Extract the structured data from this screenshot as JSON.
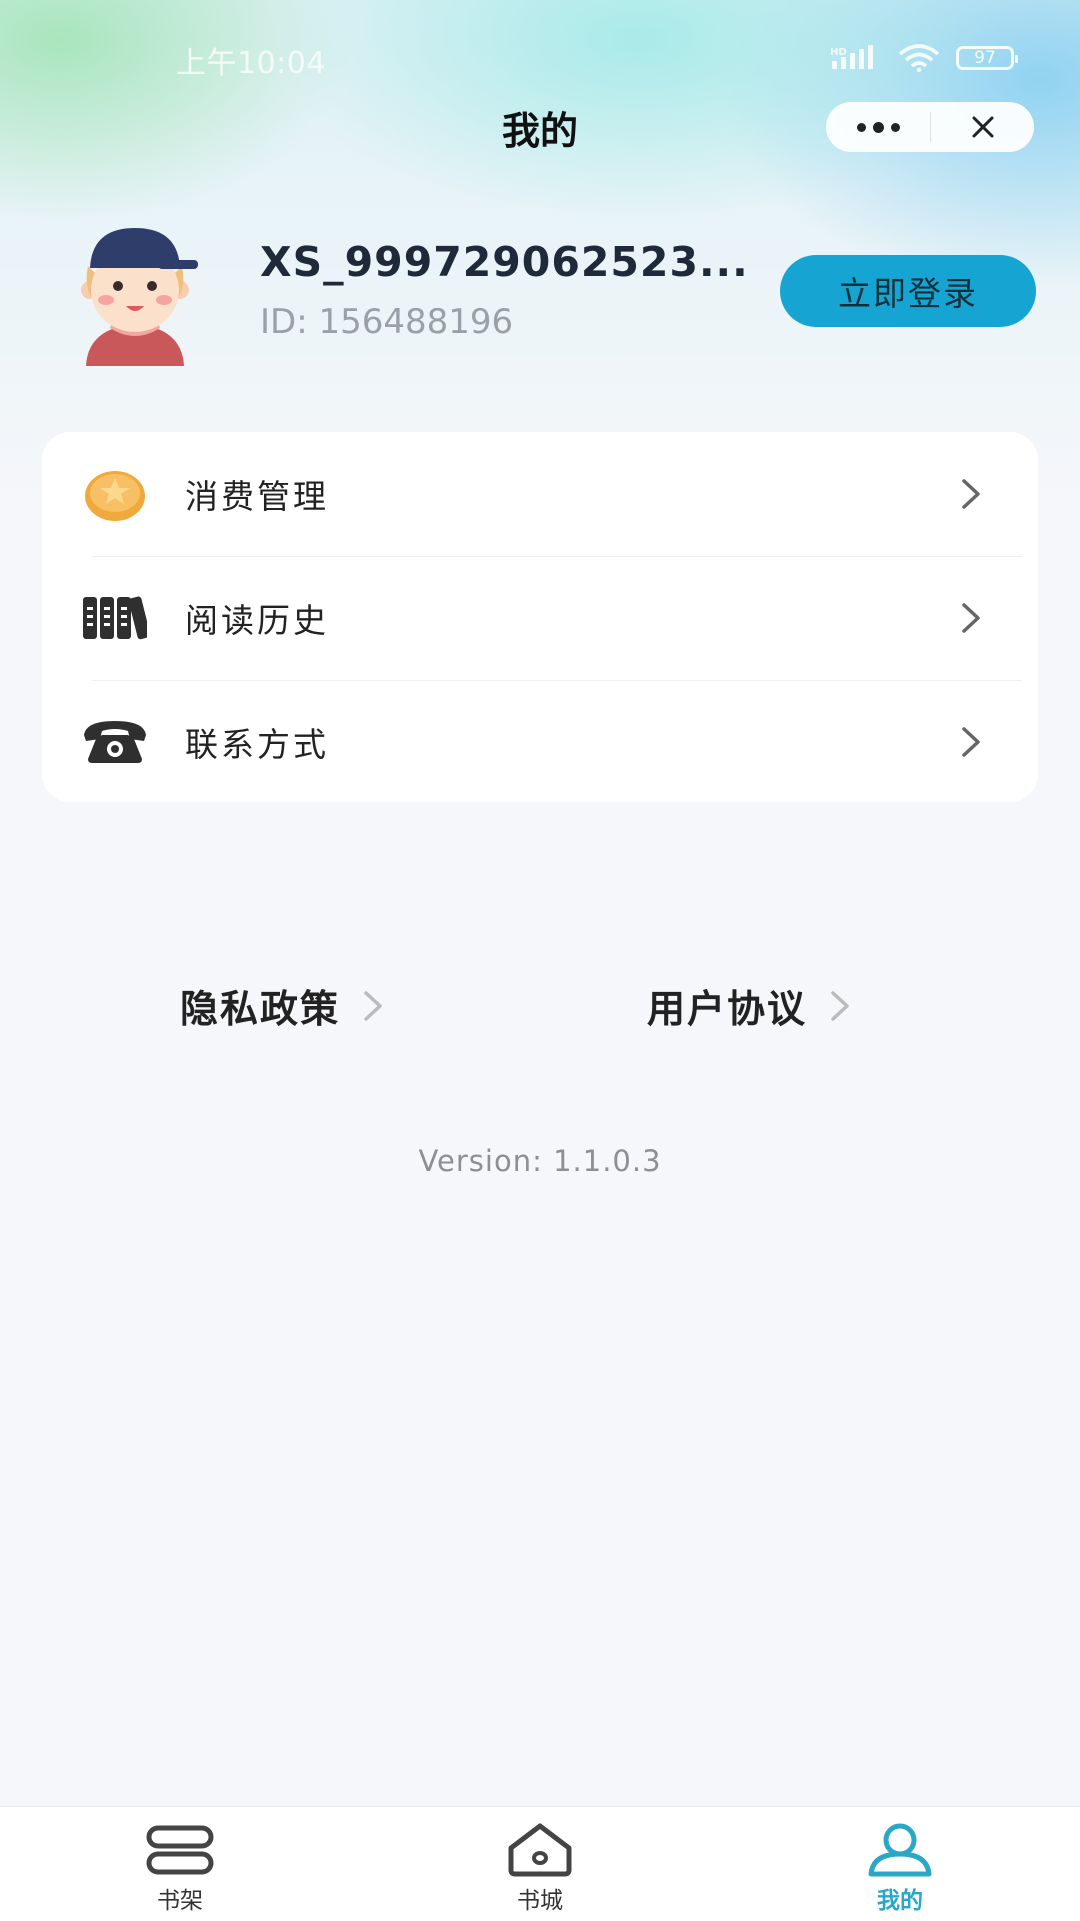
{
  "status_bar": {
    "time": "上午10:04",
    "battery": "97",
    "network_label": "HD"
  },
  "nav": {
    "title": "我的"
  },
  "profile": {
    "username": "XS_999729062523...",
    "id_text": "ID: 156488196",
    "login_label": "立即登录"
  },
  "menu": {
    "items": [
      {
        "label": "消费管理",
        "icon": "coin-icon"
      },
      {
        "label": "阅读历史",
        "icon": "books-icon"
      },
      {
        "label": "联系方式",
        "icon": "telephone-icon"
      }
    ]
  },
  "links": {
    "privacy": "隐私政策",
    "agreement": "用户协议"
  },
  "version": "Version: 1.1.0.3",
  "tabbar": {
    "items": [
      {
        "label": "书架",
        "icon": "bookshelf-icon",
        "active": false
      },
      {
        "label": "书城",
        "icon": "bookstore-icon",
        "active": false
      },
      {
        "label": "我的",
        "icon": "profile-icon",
        "active": true
      }
    ]
  },
  "colors": {
    "accent": "#16a5d2",
    "active_tab": "#2aa7c6",
    "coin": "#f2a93b"
  }
}
